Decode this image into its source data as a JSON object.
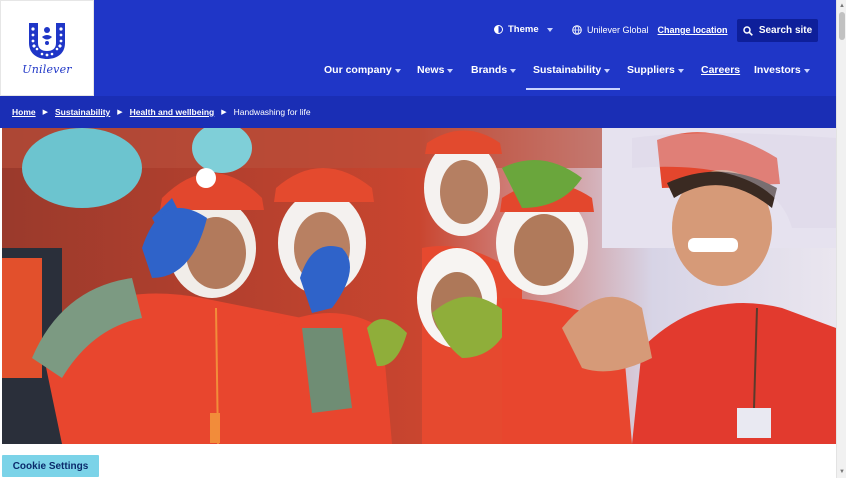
{
  "brand": {
    "logo_text": "Unilever"
  },
  "utility": {
    "theme_label": "Theme",
    "location_label": "Unilever Global",
    "change_location_label": "Change location",
    "search_label": "Search site"
  },
  "nav": {
    "items": [
      {
        "label": "Our company",
        "dropdown": true
      },
      {
        "label": "News",
        "dropdown": true
      },
      {
        "label": "Brands",
        "dropdown": true
      },
      {
        "label": "Sustainability",
        "dropdown": true,
        "active": true
      },
      {
        "label": "Suppliers",
        "dropdown": true
      },
      {
        "label": "Careers",
        "dropdown": false
      },
      {
        "label": "Investors",
        "dropdown": true
      }
    ]
  },
  "breadcrumb": [
    {
      "label": "Home"
    },
    {
      "label": "Sustainability"
    },
    {
      "label": "Health and wellbeing"
    },
    {
      "label": "Handwashing for life",
      "current": true
    }
  ],
  "hero": {
    "image": "children-with-painted-hands-photo"
  },
  "cookie": {
    "label": "Cookie Settings"
  },
  "colors": {
    "header_blue": "#1f36c7",
    "breadcrumb_blue": "#1a2eb5",
    "search_button": "#0e1f9a",
    "cookie_button": "#7bd3e8"
  },
  "icons": [
    "theme-icon",
    "globe-icon",
    "search-icon",
    "chevron-down-icon",
    "breadcrumb-separator-icon"
  ]
}
